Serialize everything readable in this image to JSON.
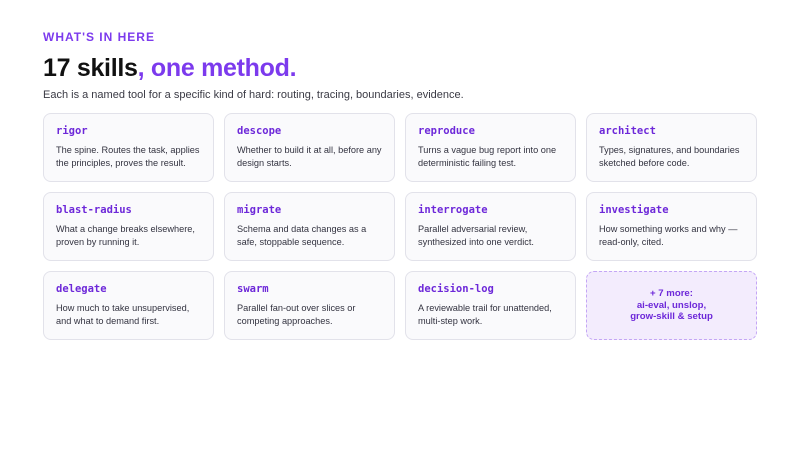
{
  "header": {
    "eyebrow": "WHAT'S IN HERE",
    "title_main": "17 skills",
    "title_accent": ", one method.",
    "subtitle": "Each is a named tool for a specific kind of hard: routing, tracing, boundaries, evidence."
  },
  "skills": [
    {
      "name": "rigor",
      "desc": "The spine. Routes the task, applies the principles, proves the result."
    },
    {
      "name": "descope",
      "desc": "Whether to build it at all, before any design starts."
    },
    {
      "name": "reproduce",
      "desc": "Turns a vague bug report into one deterministic failing test."
    },
    {
      "name": "architect",
      "desc": "Types, signatures, and boundaries sketched before code."
    },
    {
      "name": "blast-radius",
      "desc": "What a change breaks elsewhere, proven by running it."
    },
    {
      "name": "migrate",
      "desc": "Schema and data changes as a safe, stoppable sequence."
    },
    {
      "name": "interrogate",
      "desc": "Parallel adversarial review, synthesized into one verdict."
    },
    {
      "name": "investigate",
      "desc": "How something works and why — read-only, cited."
    },
    {
      "name": "delegate",
      "desc": "How much to take unsupervised, and what to demand first."
    },
    {
      "name": "swarm",
      "desc": "Parallel fan-out over slices or competing approaches."
    },
    {
      "name": "decision-log",
      "desc": "A reviewable trail for unattended, multi-step work."
    }
  ],
  "more": {
    "line1": "+ 7 more:",
    "line2": "ai-eval, unslop,",
    "line3": "grow-skill & setup"
  },
  "colors": {
    "accent": "#7c3aed",
    "card_bg": "#fafafc",
    "more_bg": "#f3ecfd"
  }
}
